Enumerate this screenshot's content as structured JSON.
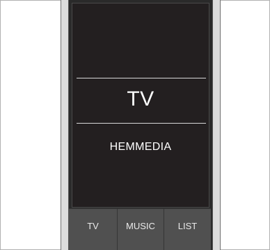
{
  "screen": {
    "source_title": "TV",
    "source_subtitle": "HEMMEDIA"
  },
  "tabs": [
    {
      "label": "TV"
    },
    {
      "label": "MUSIC"
    },
    {
      "label": "LIST"
    }
  ],
  "colors": {
    "screen_bg": "#231f20",
    "tab_bg": "#505050",
    "text": "#ffffff"
  }
}
